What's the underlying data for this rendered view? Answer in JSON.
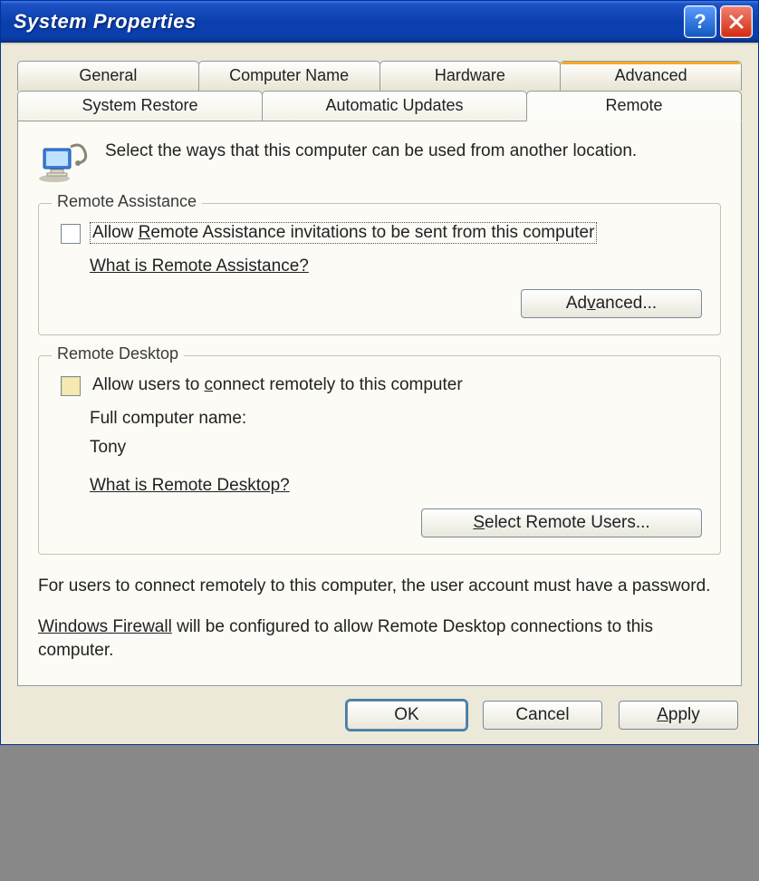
{
  "titlebar": {
    "title": "System Properties"
  },
  "tabs": {
    "row1": [
      "General",
      "Computer Name",
      "Hardware",
      "Advanced"
    ],
    "row2": [
      "System Restore",
      "Automatic Updates",
      "Remote"
    ],
    "active": "Remote"
  },
  "intro": "Select the ways that this computer can be used from another location.",
  "group_assist": {
    "legend": "Remote Assistance",
    "checkbox_pre": "Allow ",
    "checkbox_mn": "R",
    "checkbox_post": "emote Assistance invitations to be sent from this computer",
    "checked": false,
    "help_link": "What is Remote Assistance?",
    "advanced_btn_pre": "Ad",
    "advanced_btn_mn": "v",
    "advanced_btn_post": "anced..."
  },
  "group_desktop": {
    "legend": "Remote Desktop",
    "checkbox_pre": "Allow users to ",
    "checkbox_mn": "c",
    "checkbox_post": "onnect remotely to this computer",
    "checked": false,
    "full_name_label": "Full computer name:",
    "full_name_value": "Tony",
    "help_link": "What is Remote Desktop?",
    "select_btn_mn": "S",
    "select_btn_post": "elect Remote Users..."
  },
  "note1": "For users to connect remotely to this computer, the user account must have a password.",
  "note2_link": "Windows Firewall",
  "note2_rest": " will be configured to allow Remote Desktop connections to this computer.",
  "buttons": {
    "ok": "OK",
    "cancel": "Cancel",
    "apply_mn": "A",
    "apply_post": "pply"
  }
}
